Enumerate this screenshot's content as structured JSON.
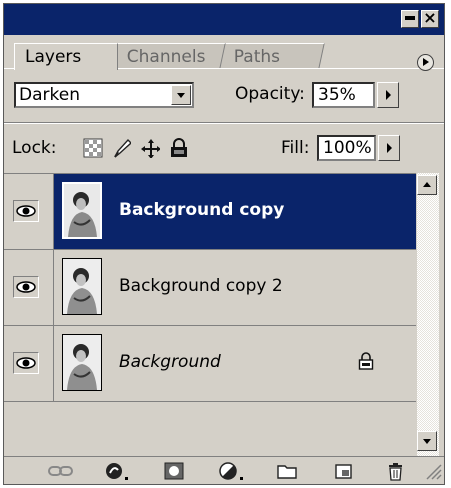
{
  "window": {
    "minimize_icon": "minimize-icon",
    "close_label": "×"
  },
  "tabs": [
    {
      "label": "Layers",
      "active": true
    },
    {
      "label": "Channels",
      "active": false
    },
    {
      "label": "Paths",
      "active": false
    }
  ],
  "blend": {
    "mode": "Darken",
    "opacity_label": "Opacity:",
    "opacity_value": "35%"
  },
  "lock": {
    "label": "Lock:",
    "icons": [
      "lock-transparent-pixels-icon",
      "lock-image-pixels-icon",
      "lock-position-icon",
      "lock-all-icon"
    ],
    "fill_label": "Fill:",
    "fill_value": "100%"
  },
  "layers": [
    {
      "name": "Background copy",
      "selected": true,
      "visible": true,
      "locked": false,
      "italic": false
    },
    {
      "name": "Background copy 2",
      "selected": false,
      "visible": true,
      "locked": false,
      "italic": false
    },
    {
      "name": "Background",
      "selected": false,
      "visible": true,
      "locked": true,
      "italic": true
    }
  ],
  "bottom_icons": [
    "link-layers-icon",
    "layer-style-icon",
    "layer-mask-icon",
    "adjustment-layer-icon",
    "new-group-icon",
    "new-layer-icon",
    "trash-icon"
  ],
  "colors": {
    "titlebar": "#0a246a",
    "panel": "#d4d0c8",
    "selection": "#0a246a"
  }
}
